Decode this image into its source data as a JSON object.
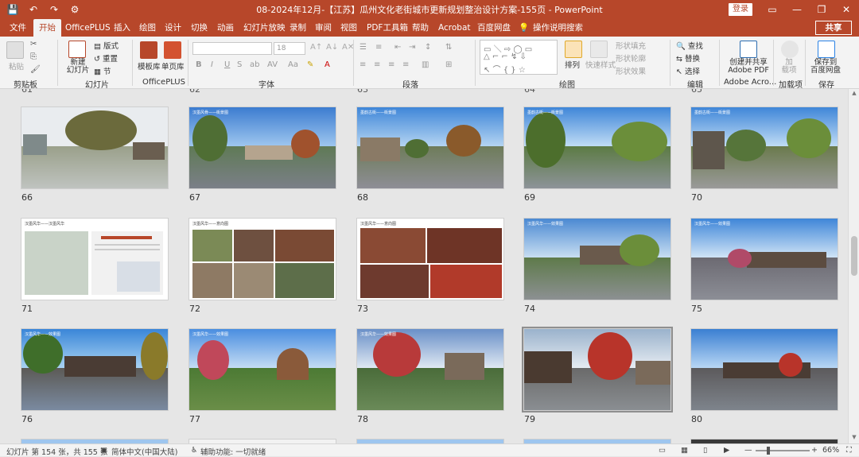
{
  "titlebar": {
    "title": "08-2024年12月-【江苏】瓜州文化老街城市更新规划整治设计方案-155页  -  PowerPoint",
    "login": "登录",
    "quick_access": [
      "save-icon",
      "undo-icon",
      "redo-icon",
      "customize-icon"
    ],
    "icons": [
      "ribbon-display-icon",
      "minimize-icon",
      "restore-icon",
      "close-icon"
    ]
  },
  "tabs": [
    "文件",
    "开始",
    "OfficePLUS",
    "插入",
    "绘图",
    "设计",
    "切换",
    "动画",
    "幻灯片放映",
    "录制",
    "审阅",
    "视图",
    "PDF工具箱",
    "帮助",
    "Acrobat",
    "百度网盘",
    "操作说明搜索"
  ],
  "share": "共享",
  "ribbon": {
    "groups": [
      "剪贴板",
      "幻灯片",
      "OfficePLUS",
      "字体",
      "段落",
      "绘图",
      "编辑",
      "Adobe Acro...",
      "加载项",
      "保存"
    ],
    "clipboard": {
      "paste": "粘贴"
    },
    "slides": {
      "new_slide": "新建\n幻灯片",
      "layout": "版式",
      "reset": "重置",
      "section": "节"
    },
    "officeplus": {
      "template_library": "模板库",
      "single_page": "单页库"
    },
    "font": {
      "font_name": "",
      "font_size": "18"
    },
    "drawing": {
      "arrange": "排列",
      "quick_styles": "快速样式",
      "shape_fill": "形状填充",
      "shape_outline": "形状轮廓",
      "shape_effects": "形状效果"
    },
    "editing": {
      "find": "查找",
      "replace": "替换",
      "select": "选择"
    },
    "adobe": {
      "create_pdf": "创建并共享\nAdobe PDF"
    },
    "addins": {
      "addins": "加\n载项"
    },
    "save": {
      "save_baidu": "保存到\n百度网盘"
    }
  },
  "slides": [
    {
      "num": "66",
      "caption": ""
    },
    {
      "num": "67",
      "caption": "汉墨风骨——街景图"
    },
    {
      "num": "68",
      "caption": "墨韵古街——街景图"
    },
    {
      "num": "69",
      "caption": "墨韵古街——街景图"
    },
    {
      "num": "70",
      "caption": "墨韵古街——街景图"
    },
    {
      "num": "71",
      "caption": "汉墨风华——汉墨风华"
    },
    {
      "num": "72",
      "caption": "汉墨风华——意向图"
    },
    {
      "num": "73",
      "caption": "汉墨风华——意向图"
    },
    {
      "num": "74",
      "caption": "汉墨风华——效果图"
    },
    {
      "num": "75",
      "caption": "汉墨风华——效果图"
    },
    {
      "num": "76",
      "caption": "汉墨风华——效果图"
    },
    {
      "num": "77",
      "caption": "汉墨风华——效果图"
    },
    {
      "num": "78",
      "caption": "汉墨风华——效果图"
    },
    {
      "num": "79",
      "caption": ""
    },
    {
      "num": "80",
      "caption": ""
    }
  ],
  "partial_numbers": [
    "61",
    "62",
    "63",
    "64",
    "65"
  ],
  "status": {
    "slide_info": "幻灯片 第 154 张，共 155 张",
    "language": "简体中文(中国大陆)",
    "accessibility": "辅助功能: 一切就绪",
    "zoom": "66%"
  }
}
